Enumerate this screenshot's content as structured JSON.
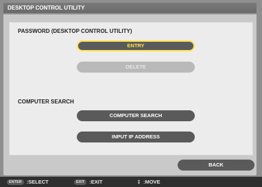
{
  "window": {
    "title": "DESKTOP CONTROL UTILITY"
  },
  "password_section": {
    "label": "PASSWORD (DESKTOP CONTROL UTILITY)",
    "entry_label": "ENTRY",
    "delete_label": "DELETE"
  },
  "computer_search_section": {
    "label": "COMPUTER SEARCH",
    "search_label": "COMPUTER SEARCH",
    "input_ip_label": "INPUT IP ADDRESS"
  },
  "back_label": "BACK",
  "statusbar": {
    "enter_key": "ENTER",
    "select_text": ":SELECT",
    "exit_key": "EXIT",
    "exit_text": ":EXIT",
    "move_text": ":MOVE"
  },
  "colors": {
    "selected_outline": "#ffe14a",
    "button_dark": "#5a5a5a",
    "button_disabled": "#b9b9b9"
  }
}
